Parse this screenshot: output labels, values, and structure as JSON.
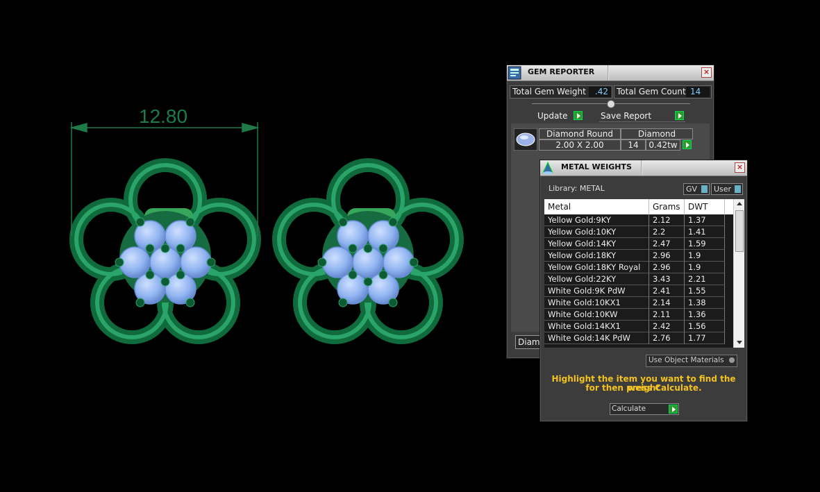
{
  "viewport": {
    "dimension_value": "12.80",
    "metal_color": "#1a8a52",
    "gem_color": "#8fb3f0"
  },
  "gem_reporter": {
    "title": "GEM REPORTER",
    "total_weight_label": "Total Gem Weight",
    "total_weight_value": ".42",
    "total_count_label": "Total Gem Count",
    "total_count_value": "14",
    "update_label": "Update",
    "save_report_label": "Save Report",
    "gem": {
      "name": "Diamond Round",
      "size": "2.00 X 2.00",
      "material": "Diamond",
      "count": "14",
      "weight": "0.42tw"
    },
    "bottom_tab_label": "Diamo"
  },
  "metal_weights": {
    "title": "METAL WEIGHTS",
    "library_label": "Library: METAL",
    "gv_label": "GV",
    "user_label": "User",
    "columns": [
      "Metal",
      "Grams",
      "DWT"
    ],
    "rows": [
      {
        "metal": "Yellow Gold:9KY",
        "grams": "2.12",
        "dwt": "1.37"
      },
      {
        "metal": "Yellow Gold:10KY",
        "grams": "2.2",
        "dwt": "1.41"
      },
      {
        "metal": "Yellow Gold:14KY",
        "grams": "2.47",
        "dwt": "1.59"
      },
      {
        "metal": "Yellow Gold:18KY",
        "grams": "2.96",
        "dwt": "1.9"
      },
      {
        "metal": "Yellow Gold:18KY Royal",
        "grams": "2.96",
        "dwt": "1.9"
      },
      {
        "metal": "Yellow Gold:22KY",
        "grams": "3.43",
        "dwt": "2.21"
      },
      {
        "metal": "White Gold:9K PdW",
        "grams": "2.41",
        "dwt": "1.55"
      },
      {
        "metal": "White Gold:10KX1",
        "grams": "2.14",
        "dwt": "1.38"
      },
      {
        "metal": "White Gold:10KW",
        "grams": "2.11",
        "dwt": "1.36"
      },
      {
        "metal": "White Gold:14KX1",
        "grams": "2.42",
        "dwt": "1.56"
      },
      {
        "metal": "White Gold:14K PdW",
        "grams": "2.76",
        "dwt": "1.77"
      }
    ],
    "use_object_materials_label": "Use Object Materials",
    "hint_line1": "Highlight the item you want to find the weight",
    "hint_line2": "for then press Calculate.",
    "calculate_label": "Calculate"
  }
}
